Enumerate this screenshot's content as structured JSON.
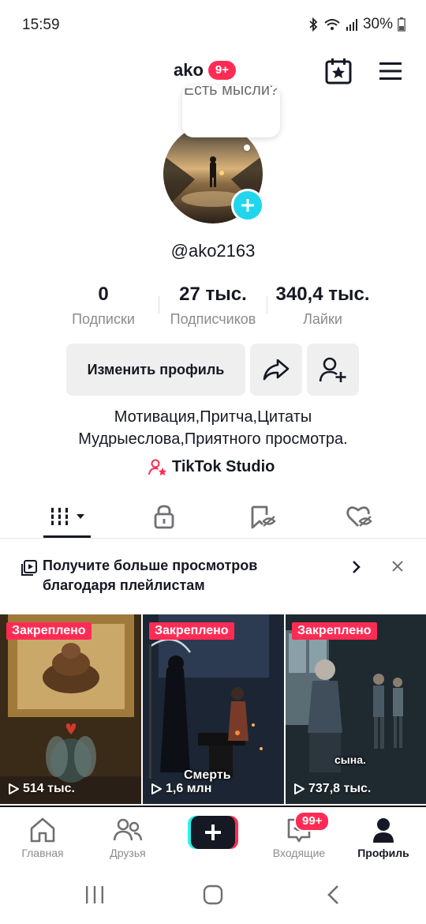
{
  "status_bar": {
    "time": "15:59",
    "battery": "30%",
    "icons": [
      "bluetooth-icon",
      "wifi-icon",
      "signal-icon",
      "battery-icon"
    ]
  },
  "header": {
    "title": "ako",
    "badge": "9+",
    "calendar_icon": "calendar-star-icon",
    "menu_icon": "hamburger-menu-icon"
  },
  "profile": {
    "thought_bubble": "Есть мысли?",
    "username": "@ako2163",
    "stats": [
      {
        "value": "0",
        "label": "Подписки"
      },
      {
        "value": "27 тыс.",
        "label": "Подписчиков"
      },
      {
        "value": "340,4 тыс.",
        "label": "Лайки"
      }
    ],
    "edit_button": "Изменить профиль",
    "bio_line1": "Мотивация,Притча,Цитаты",
    "bio_line2": "Мудрыеслова,Приятного просмотра.",
    "studio_link": "TikTok Studio"
  },
  "tabs": [
    {
      "name": "videos",
      "icon": "grid-bars-icon",
      "active": true
    },
    {
      "name": "private",
      "icon": "lock-icon",
      "active": false
    },
    {
      "name": "reposts",
      "icon": "bookmark-hidden-icon",
      "active": false
    },
    {
      "name": "liked",
      "icon": "heart-hidden-icon",
      "active": false
    }
  ],
  "banner": {
    "text_line1": "Получите больше просмотров",
    "text_line2": "благодаря плейлистам"
  },
  "videos": [
    {
      "pinned_label": "Закреплено",
      "views": "514 тыс.",
      "caption": ""
    },
    {
      "pinned_label": "Закреплено",
      "views": "1,6 млн",
      "caption": "Смерть"
    },
    {
      "pinned_label": "Закреплено",
      "views": "737,8 тыс.",
      "caption": "сына."
    }
  ],
  "bottom_nav": {
    "home": "Главная",
    "friends": "Друзья",
    "inbox": "Входящие",
    "inbox_badge": "99+",
    "profile": "Профиль"
  },
  "colors": {
    "accent": "#fe2c55",
    "avatar_add": "#20d5ec",
    "plus_cyan": "#25f4ee",
    "text_primary": "#161823",
    "text_secondary": "#8a8b91"
  }
}
